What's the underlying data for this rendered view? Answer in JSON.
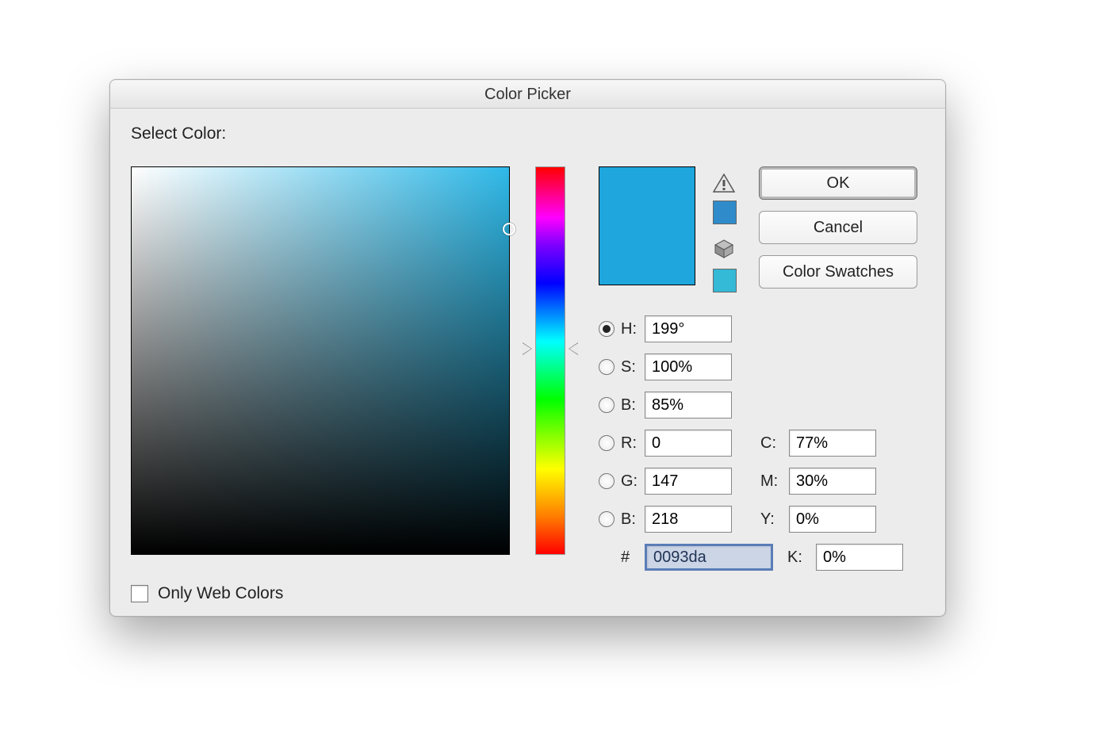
{
  "title": "Color Picker",
  "section_label": "Select Color:",
  "buttons": {
    "ok": "OK",
    "cancel": "Cancel",
    "swatches": "Color Swatches"
  },
  "preview": {
    "new_color": "#1ea6dd",
    "warning_swatch": "#2f8bc9",
    "cube_swatch": "#34b9d6"
  },
  "fields": {
    "h": {
      "label": "H:",
      "value": "199°",
      "selected": true
    },
    "s": {
      "label": "S:",
      "value": "100%",
      "selected": false
    },
    "br": {
      "label": "B:",
      "value": "85%",
      "selected": false
    },
    "r": {
      "label": "R:",
      "value": "0",
      "selected": false
    },
    "g": {
      "label": "G:",
      "value": "147",
      "selected": false
    },
    "b": {
      "label": "B:",
      "value": "218",
      "selected": false
    },
    "hex": {
      "label": "#",
      "value": "0093da"
    },
    "c": {
      "label": "C:",
      "value": "77%"
    },
    "m": {
      "label": "M:",
      "value": "30%"
    },
    "y": {
      "label": "Y:",
      "value": "0%"
    },
    "k": {
      "label": "K:",
      "value": "0%"
    }
  },
  "footer": {
    "only_web": "Only Web Colors",
    "checked": false
  },
  "icons": {
    "warning": "warning-triangle-icon",
    "cube": "cube-icon"
  }
}
